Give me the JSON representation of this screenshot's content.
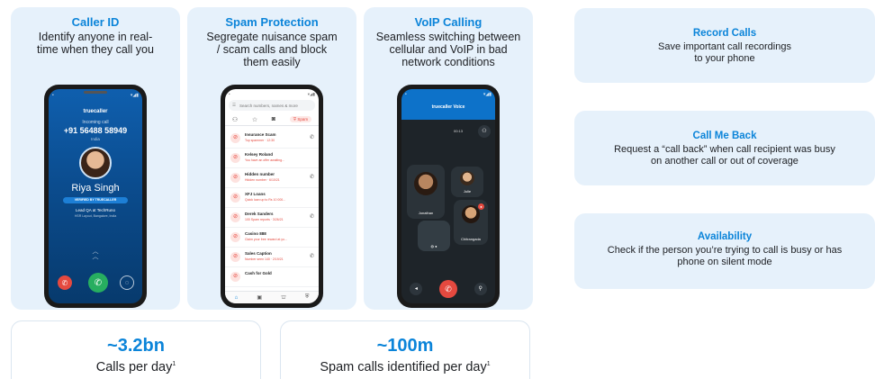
{
  "features": [
    {
      "title": "Caller ID",
      "desc": "Identify anyone in real-time when they call you"
    },
    {
      "title": "Spam Protection",
      "desc": "Segregate nuisance spam / scam calls and block them easily"
    },
    {
      "title": "VoIP Calling",
      "desc": "Seamless switching between cellular and VoIP in bad network conditions"
    }
  ],
  "caller_screen": {
    "app_name": "truecaller",
    "incoming_label": "Incoming call",
    "number": "+91 56488 58949",
    "location": "India",
    "name": "Riya Singh",
    "badge": "VERIFIED BY TRUECALLER",
    "job": "Lead QA at TechRuno",
    "address": "HSR Layout, Bangalore, India"
  },
  "spam_screen": {
    "search_placeholder": "Search numbers, names & more",
    "spam_tab": "Spam",
    "rows": [
      {
        "name": "Insurance Scam",
        "sub": "Top spammer · 12:30"
      },
      {
        "name": "Kelsey Roland",
        "sub": "You have an offer awaiting..."
      },
      {
        "name": "Hidden number",
        "sub": "Hidden number · 6/10/21"
      },
      {
        "name": "XFJ Loans",
        "sub": "Quick loan up to Rs 10 000..."
      },
      {
        "name": "Derek Sanders",
        "sub": "100 Spam reports · 3/26/21"
      },
      {
        "name": "Casino 888",
        "sub": "Claim your free reward at yo..."
      },
      {
        "name": "Sales Caption",
        "sub": "Number seen 140 · 2/19/21"
      },
      {
        "name": "Cash for Gold",
        "sub": ""
      }
    ]
  },
  "voip_screen": {
    "title": "truecaller Voice",
    "timer": "00:13",
    "participants": [
      "Jonathan",
      "Julie",
      "Chitrangada"
    ]
  },
  "side_cards": [
    {
      "title": "Record Calls",
      "desc": "Save important call recordings to your phone"
    },
    {
      "title": "Call Me Back",
      "desc": "Request a “call back” when call recipient was busy on another call or out of coverage"
    },
    {
      "title": "Availability",
      "desc": "Check if the person you’re trying to call is busy or has phone on silent mode"
    }
  ],
  "stats": [
    {
      "value": "~3.2bn",
      "label": "Calls per day",
      "note": "1"
    },
    {
      "value": "~100m",
      "label": "Spam calls identified per day",
      "note": "1"
    }
  ],
  "colors": {
    "accent": "#0b84d9",
    "card_bg": "#e6f1fb",
    "danger": "#e5493f",
    "accept": "#27ae60"
  }
}
